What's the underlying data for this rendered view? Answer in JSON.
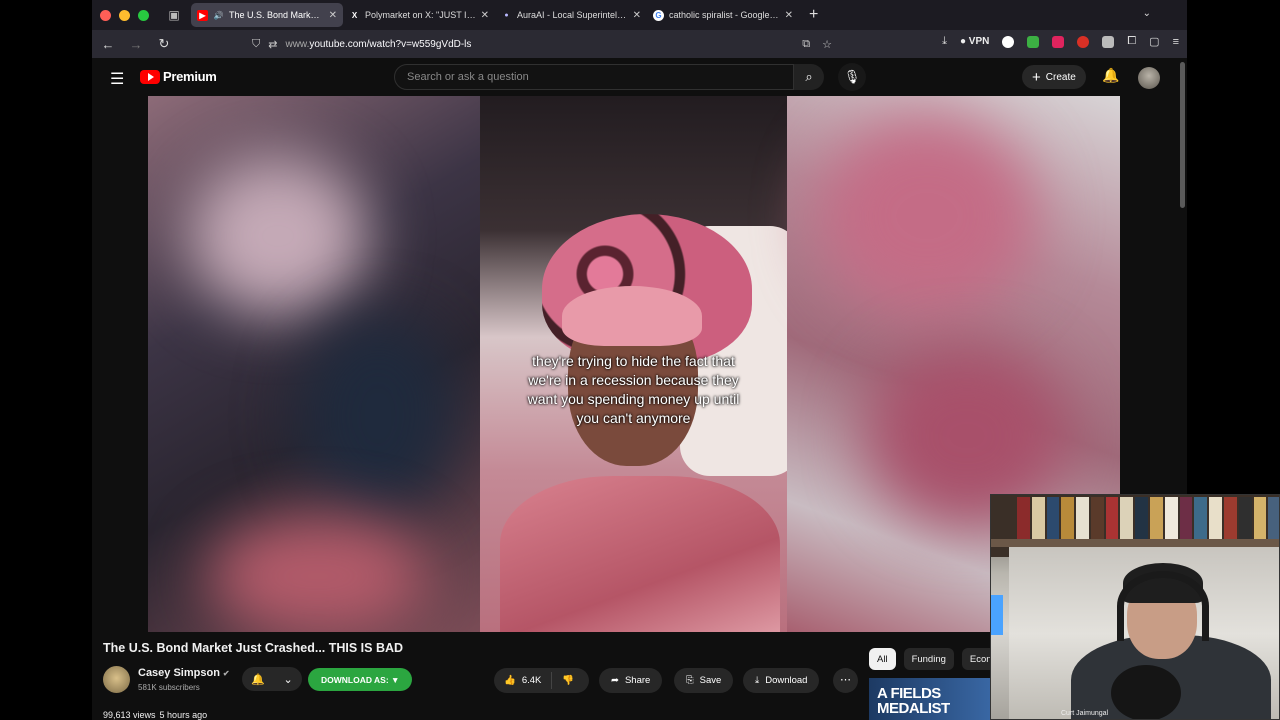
{
  "browser": {
    "tabs": [
      {
        "label": "The U.S. Bond Market Just",
        "favicon": "youtube-icon",
        "active": true
      },
      {
        "label": "Polymarket on X: \"JUST IN: It's",
        "favicon": "x-icon",
        "active": false
      },
      {
        "label": "AuraAI - Local Superintelligence",
        "favicon": "aura-icon",
        "active": false
      },
      {
        "label": "catholic spiralist - Google Search",
        "favicon": "google-icon",
        "active": false
      }
    ],
    "url_prefix": "www.",
    "url_main": "youtube.com/watch?v=w559gVdD-ls",
    "vpn_label": "VPN"
  },
  "youtube": {
    "brand": "Premium",
    "search_placeholder": "Search or ask a question",
    "create_label": "Create"
  },
  "video": {
    "caption": "they're trying to hide the fact that we're in a recession because they want you spending money up until you can't anymore",
    "title": "The U.S. Bond Market Just Crashed... THIS IS BAD",
    "channel": "Casey Simpson",
    "subscribers": "581K subscribers",
    "download_as_label": "DOWNLOAD AS: ▼",
    "likes": "6.4K",
    "share_label": "Share",
    "save_label": "Save",
    "download_label": "Download",
    "views": "99,613 views",
    "uploaded": "5 hours ago"
  },
  "chips": [
    "All",
    "Funding",
    "Econ"
  ],
  "thumbnail_text": "A FIELDS MEDALIST",
  "webcam_label": "Curt Jaimungal"
}
